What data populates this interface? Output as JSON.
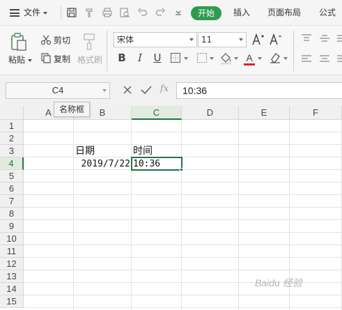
{
  "menubar": {
    "file_label": "文件",
    "tabs": [
      {
        "label": "开始",
        "active": true
      },
      {
        "label": "插入",
        "active": false
      },
      {
        "label": "页面布局",
        "active": false
      },
      {
        "label": "公式",
        "active": false
      }
    ],
    "quick_icons": [
      "save-icon",
      "format-painter-icon",
      "print-icon",
      "print-preview-icon",
      "undo-icon",
      "redo-icon",
      "customize-icon"
    ]
  },
  "ribbon": {
    "paste_label": "粘贴",
    "cut_label": "剪切",
    "copy_label": "复制",
    "format_painter_label": "格式刷",
    "font_name": "宋体",
    "font_size": "11",
    "bold": "B",
    "italic": "I",
    "underline": "U",
    "font_color": "#e02020"
  },
  "formula_bar": {
    "name_box": "C4",
    "name_box_tooltip": "名称框",
    "fx_label": "fx",
    "value": "10:36"
  },
  "sheet": {
    "columns": [
      "A",
      "B",
      "C",
      "D",
      "E",
      "F"
    ],
    "selected_column": "C",
    "rows": [
      "1",
      "2",
      "3",
      "4",
      "5",
      "6",
      "7",
      "8",
      "9",
      "10",
      "11",
      "12",
      "13",
      "14",
      "15"
    ],
    "selected_row": "4",
    "cells": {
      "B3": "日期",
      "C3": "时间",
      "B4": "2019/7/22",
      "C4": "10:36"
    },
    "selection_color": "#217346"
  },
  "watermark": "Baidu 经验"
}
